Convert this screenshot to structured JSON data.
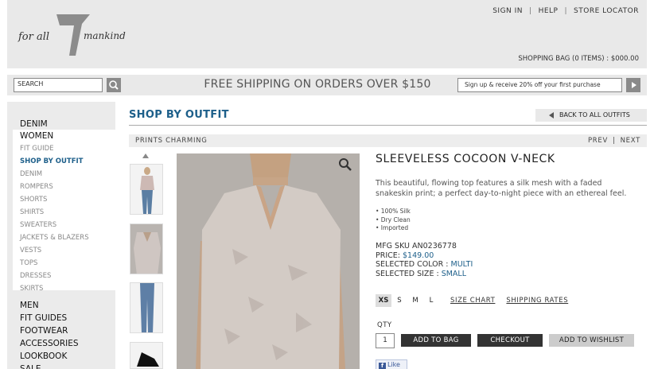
{
  "header": {
    "logo_text": "for all 7 mankind",
    "top_links": [
      "SIGN IN",
      "HELP",
      "STORE LOCATOR"
    ],
    "bag": "SHOPPING BAG (0 ITEMS) : $000.00"
  },
  "search": {
    "placeholder": "SEARCH",
    "promo": "FREE SHIPPING ON ORDERS OVER $150",
    "signup_placeholder": "Sign up & receive 20% off your first purchase"
  },
  "sidebar": {
    "top": [
      "DENIM"
    ],
    "women_label": "WOMEN",
    "women_items": [
      "FIT GUIDE",
      "SHOP BY OUTFIT",
      "DENIM",
      "ROMPERS",
      "SHORTS",
      "SHIRTS",
      "SWEATERS",
      "JACKETS & BLAZERS",
      "VESTS",
      "TOPS",
      "DRESSES",
      "SKIRTS"
    ],
    "bottom": [
      "MEN",
      "FIT GUIDES",
      "FOOTWEAR",
      "ACCESSORIES",
      "LOOKBOOK",
      "SALE"
    ]
  },
  "main": {
    "title": "SHOP BY OUTFIT",
    "back_label": "BACK TO ALL OUTFITS",
    "outfit_name": "PRINTS CHARMING",
    "prev": "PREV",
    "sep": "|",
    "next": "NEXT"
  },
  "product": {
    "name": "SLEEVELESS COCOON V-NECK",
    "description": "This beautiful, flowing top features a silk mesh with a faded snakeskin print; a perfect day-to-night piece with an ethereal feel.",
    "bullets": [
      "• 100% Silk",
      "• Dry Clean",
      "• Imported"
    ],
    "sku": "MFG SKU AN0236778",
    "price_label": "PRICE:",
    "price": "$149.00",
    "color_label": "SELECTED COLOR :",
    "color": "MULTI",
    "size_label": "SELECTED SIZE :",
    "size": "SMALL",
    "sizes": [
      "XS",
      "S",
      "M",
      "L"
    ],
    "size_chart": "SIZE CHART",
    "shipping_rates": "SHIPPING RATES",
    "qty_label": "QTY",
    "qty": "1",
    "add_to_bag": "ADD TO BAG",
    "checkout": "CHECKOUT",
    "add_to_wishlist": "ADD TO WISHLIST",
    "like": "Like"
  },
  "colors": {
    "accent_blue": "#1d5f8a",
    "panel_gray": "#e9e9e9",
    "button_dark": "#333333"
  }
}
